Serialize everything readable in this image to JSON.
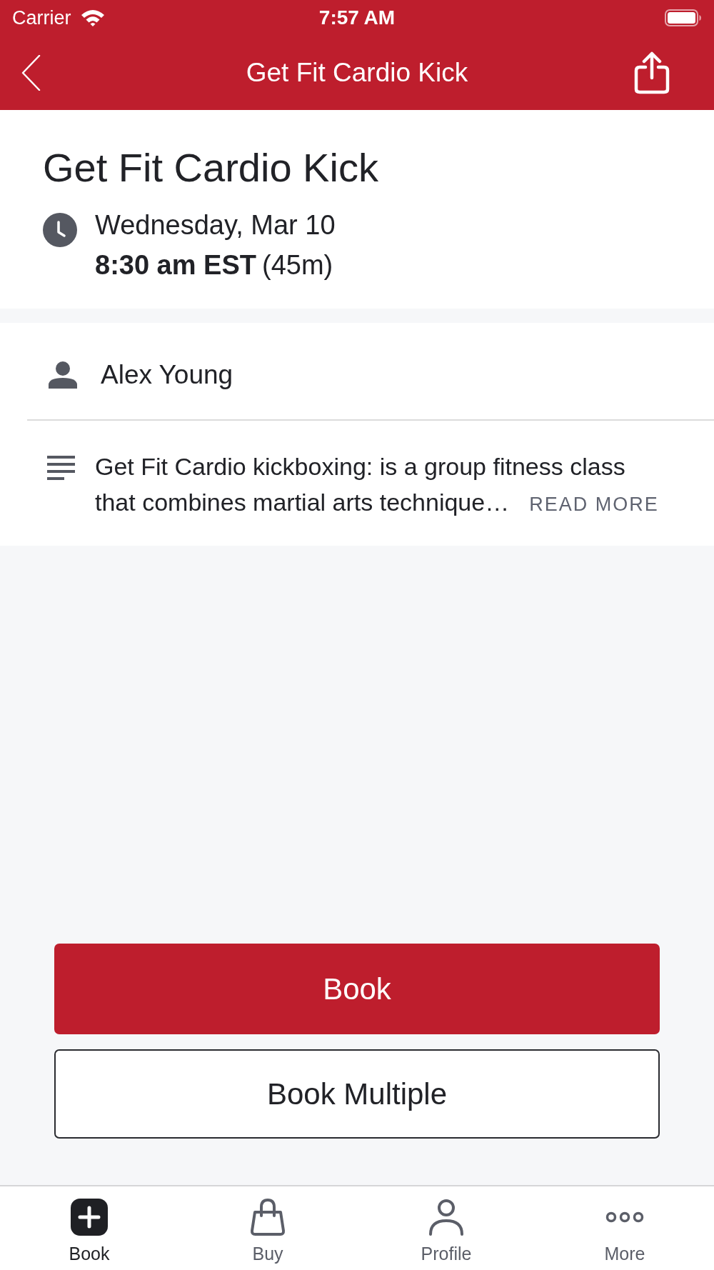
{
  "status_bar": {
    "carrier": "Carrier",
    "time": "7:57 AM"
  },
  "nav_bar": {
    "title": "Get Fit Cardio Kick"
  },
  "class_header": {
    "title": "Get Fit Cardio Kick",
    "date": "Wednesday, Mar 10",
    "time": "8:30 am EST",
    "duration": "(45m)"
  },
  "instructor": {
    "name": "Alex Young"
  },
  "description": {
    "text": "Get Fit Cardio kickboxing: is a group fitness class that combines martial arts technique…",
    "link": "READ MORE"
  },
  "actions": [
    {
      "label": "Book",
      "kind": "primary"
    },
    {
      "label": "Book Multiple",
      "kind": "outline"
    }
  ],
  "tab_bar": [
    {
      "label": "Book",
      "selected": true
    },
    {
      "label": "Buy",
      "selected": false
    },
    {
      "label": "Profile",
      "selected": false
    },
    {
      "label": "More",
      "selected": false
    }
  ]
}
